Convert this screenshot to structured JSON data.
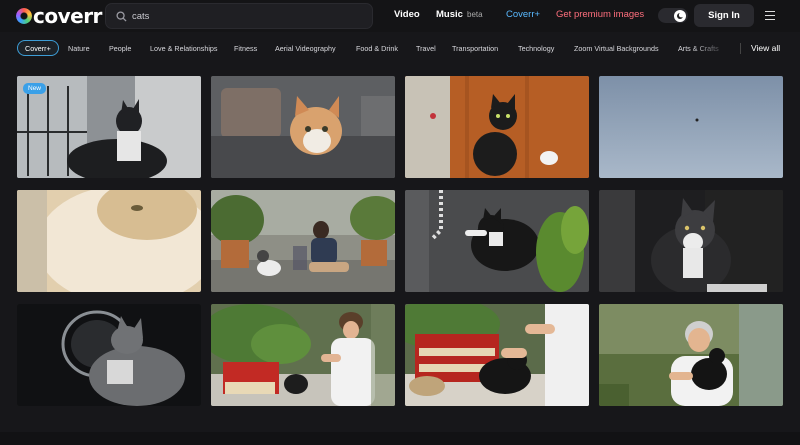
{
  "header": {
    "logo_text": "coverr",
    "search": {
      "value": "cats",
      "placeholder": ""
    },
    "nav": {
      "video": "Video",
      "music": "Music",
      "music_badge": "beta",
      "coverr_plus": "Coverr+",
      "premium_images": "Get premium images"
    },
    "signin": "Sign In"
  },
  "categories": [
    "Coverr+",
    "Nature",
    "People",
    "Love & Relationships",
    "Fitness",
    "Aerial Videography",
    "Food & Drink",
    "Travel",
    "Transportation",
    "Technology",
    "Zoom Virtual Backgrounds",
    "Arts & Crafts"
  ],
  "view_all": "View all",
  "tiles": {
    "t1_badge": "New"
  },
  "colors": {
    "accent_blue": "#59b9ff",
    "premium_red": "#ff6f7d",
    "active_cat_border": "#3d9dd6"
  }
}
